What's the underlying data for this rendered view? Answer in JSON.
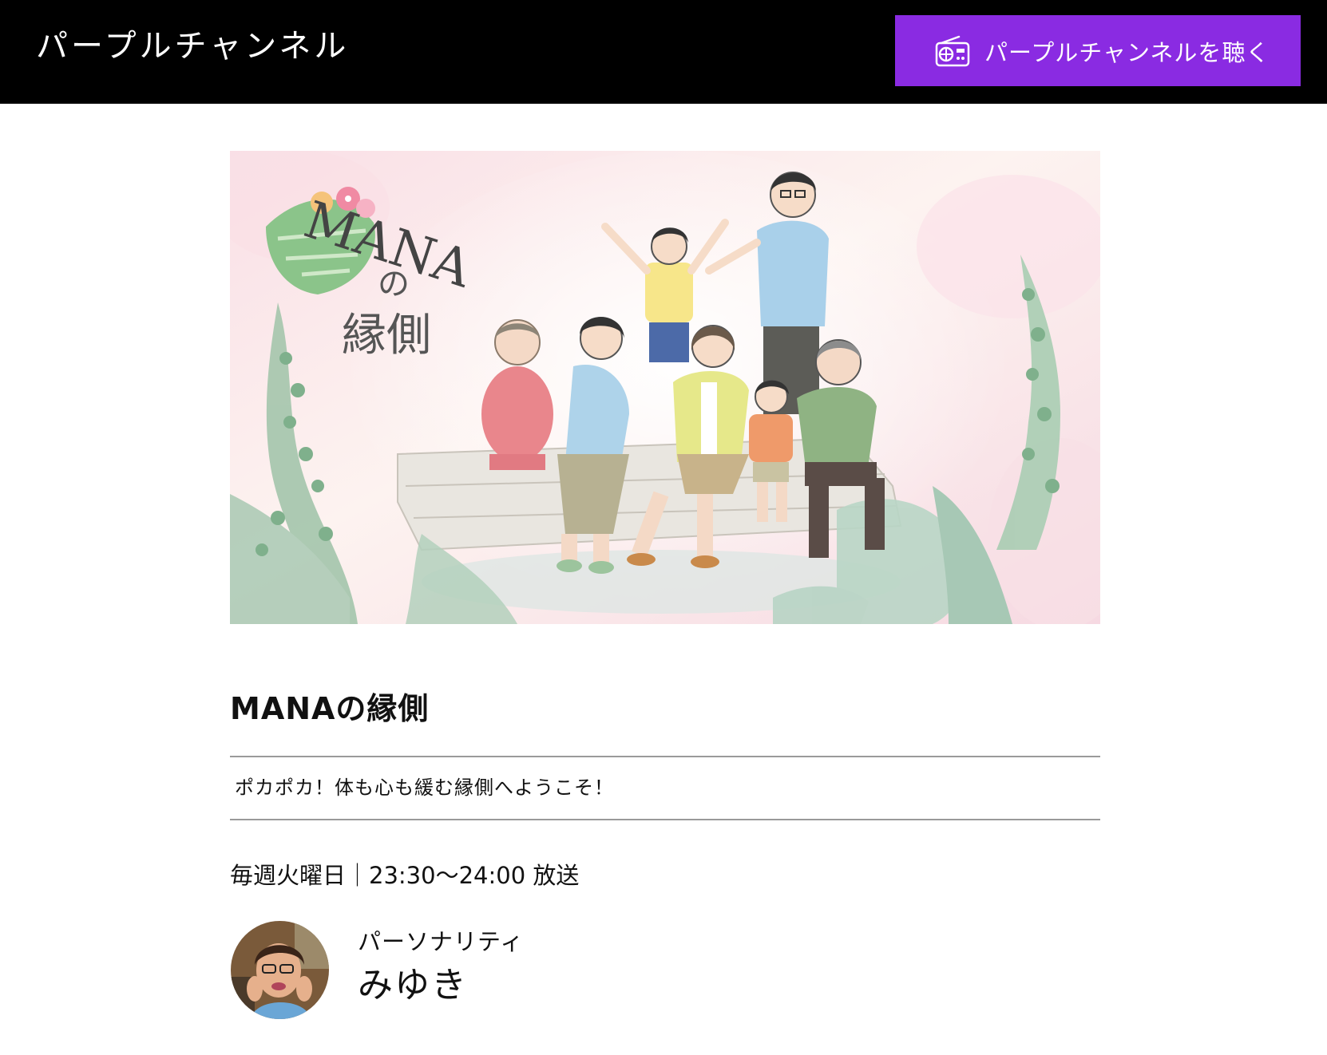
{
  "header": {
    "site_title": "パープルチャンネル",
    "listen_button_label": "パープルチャンネルを聴く",
    "listen_button_icon": "radio-icon",
    "accent_color": "#8a2be2"
  },
  "hero": {
    "logo_title": "MANA",
    "logo_particle": "の",
    "logo_subtitle": "縁側"
  },
  "program": {
    "title": "MANAの縁側",
    "description": "ポカポカ！体も心も緩む縁側へようこそ！",
    "schedule": "毎週火曜日｜23:30〜24:00 放送"
  },
  "personality": {
    "label": "パーソナリティ",
    "name": "みゆき"
  }
}
